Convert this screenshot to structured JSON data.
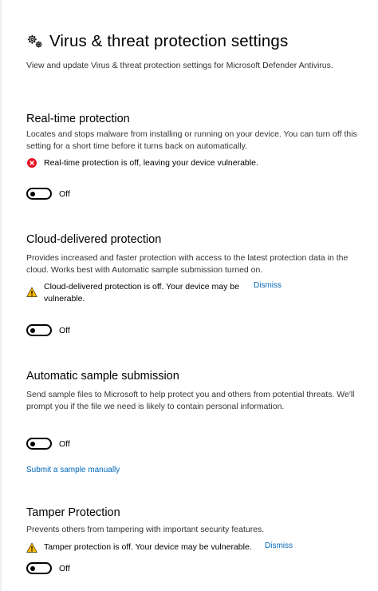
{
  "header": {
    "title": "Virus & threat protection settings",
    "icon": "gears-icon",
    "description": "View and update Virus & threat protection settings for Microsoft Defender Antivirus."
  },
  "sections": {
    "realtime": {
      "title": "Real-time protection",
      "description": "Locates and stops malware from installing or running on your device. You can turn off this setting for a short time before it turns back on automatically.",
      "alert": {
        "icon": "error-icon",
        "color": "#e81123",
        "text": "Real-time protection is off, leaving your device vulnerable."
      },
      "toggle": {
        "state": "off",
        "label": "Off"
      }
    },
    "cloud": {
      "title": "Cloud-delivered protection",
      "description": "Provides increased and faster protection with access to the latest protection data in the cloud. Works best with Automatic sample submission turned on.",
      "alert": {
        "icon": "warning-icon",
        "color": "#ffb900",
        "text": "Cloud-delivered protection is off. Your device may be vulnerable.",
        "dismiss": "Dismiss"
      },
      "toggle": {
        "state": "off",
        "label": "Off"
      }
    },
    "sample": {
      "title": "Automatic sample submission",
      "description": "Send sample files to Microsoft to help protect you and others from potential threats. We'll prompt you if the file we need is likely to contain personal information.",
      "toggle": {
        "state": "off",
        "label": "Off"
      },
      "link": "Submit a sample manually"
    },
    "tamper": {
      "title": "Tamper Protection",
      "description": "Prevents others from tampering with important security features.",
      "alert": {
        "icon": "warning-icon",
        "color": "#ffb900",
        "text": "Tamper protection is off. Your device may be vulnerable.",
        "dismiss": "Dismiss"
      },
      "toggle": {
        "state": "off",
        "label": "Off"
      }
    }
  },
  "colors": {
    "link": "#0067b8",
    "error": "#e81123",
    "warning": "#ffb900"
  }
}
